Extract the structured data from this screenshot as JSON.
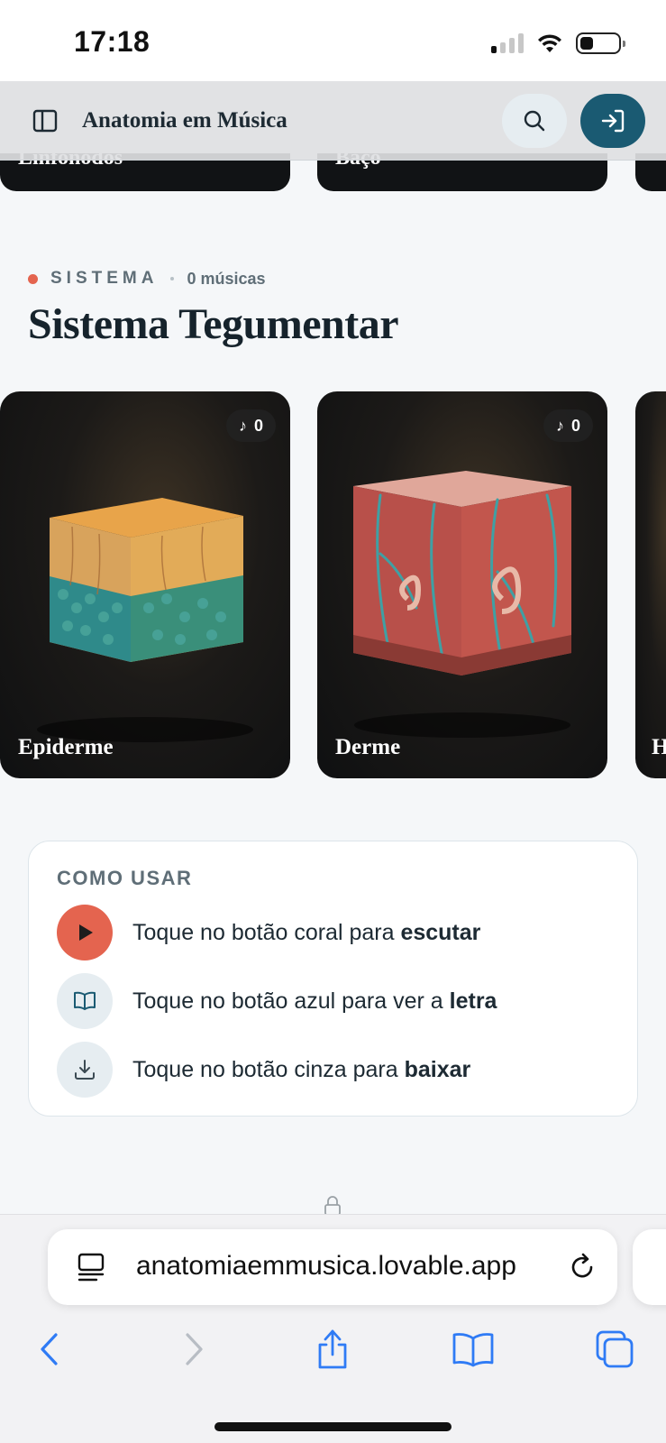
{
  "status_bar": {
    "time": "17:18",
    "signal_bars_filled": 1,
    "signal_bars_total": 4,
    "battery_level": 0.3
  },
  "top_strip": {
    "cards": [
      "Linfonodos",
      "Baço",
      ""
    ]
  },
  "header": {
    "title": "Anatomia em Música"
  },
  "section": {
    "kicker": "SISTEMA",
    "count": "0 músicas",
    "title": "Sistema Tegumentar"
  },
  "cards": [
    {
      "label": "Epiderme",
      "badge": "0"
    },
    {
      "label": "Derme",
      "badge": "0"
    },
    {
      "label": "H",
      "badge": ""
    }
  ],
  "how_to": {
    "title": "COMO USAR",
    "rows": [
      {
        "text": "Toque no botão coral para ",
        "bold": "escutar",
        "icon": "play-icon"
      },
      {
        "text": "Toque no botão azul para ver a ",
        "bold": "letra",
        "icon": "book-icon"
      },
      {
        "text": "Toque no botão cinza para ",
        "bold": "baixar",
        "icon": "download-icon"
      }
    ]
  },
  "browser": {
    "url": "anatomiaemmusica.lovable.app"
  },
  "colors": {
    "coral": "#e4644f",
    "teal": "#1a5a72",
    "ios_blue": "#2f7bf5"
  }
}
